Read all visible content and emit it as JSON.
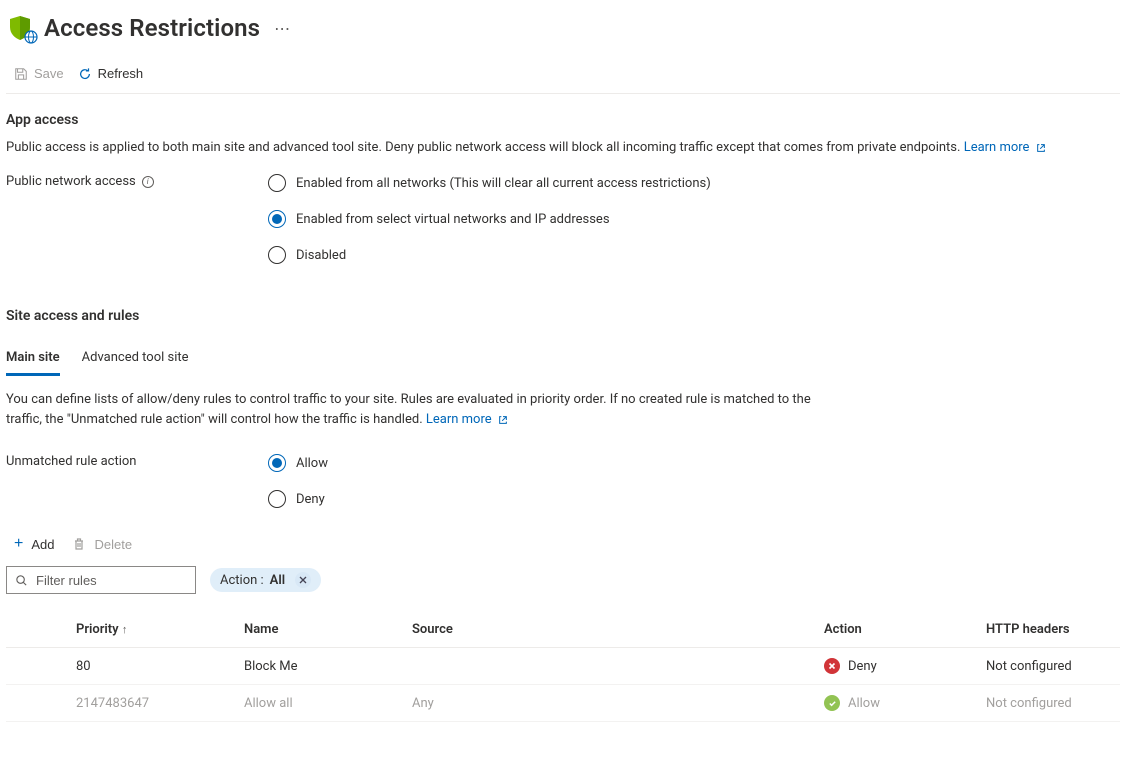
{
  "page": {
    "title": "Access Restrictions"
  },
  "toolbar": {
    "save": "Save",
    "refresh": "Refresh"
  },
  "appAccess": {
    "heading": "App access",
    "description": "Public access is applied to both main site and advanced tool site. Deny public network access will block all incoming traffic except that comes from private endpoints.",
    "learnMore": "Learn more",
    "publicNetworkAccessLabel": "Public network access",
    "options": {
      "enabledAll": "Enabled from all networks (This will clear all current access restrictions)",
      "enabledSelect": "Enabled from select virtual networks and IP addresses",
      "disabled": "Disabled"
    },
    "selectedOption": "enabledSelect"
  },
  "siteAccess": {
    "heading": "Site access and rules",
    "tabs": {
      "main": "Main site",
      "advanced": "Advanced tool site"
    },
    "activeTab": "main",
    "description": "You can define lists of allow/deny rules to control traffic to your site. Rules are evaluated in priority order. If no created rule is matched to the traffic, the \"Unmatched rule action\" will control how the traffic is handled.",
    "learnMore": "Learn more",
    "unmatchedRuleActionLabel": "Unmatched rule action",
    "unmatchedOptions": {
      "allow": "Allow",
      "deny": "Deny"
    },
    "unmatchedSelected": "allow"
  },
  "rulesToolbar": {
    "add": "Add",
    "delete": "Delete"
  },
  "filter": {
    "placeholder": "Filter rules",
    "pill": {
      "key": "Action : ",
      "value": "All"
    }
  },
  "table": {
    "headers": {
      "priority": "Priority",
      "name": "Name",
      "source": "Source",
      "action": "Action",
      "http": "HTTP headers"
    },
    "rows": [
      {
        "priority": "80",
        "name": "Block Me",
        "source": "",
        "action": "Deny",
        "actionType": "deny",
        "http": "Not configured",
        "muted": false
      },
      {
        "priority": "2147483647",
        "name": "Allow all",
        "source": "Any",
        "action": "Allow",
        "actionType": "allow",
        "http": "Not configured",
        "muted": true
      }
    ]
  },
  "colors": {
    "link": "#0067b8",
    "deny": "#d13438",
    "allow": "#92c353"
  }
}
